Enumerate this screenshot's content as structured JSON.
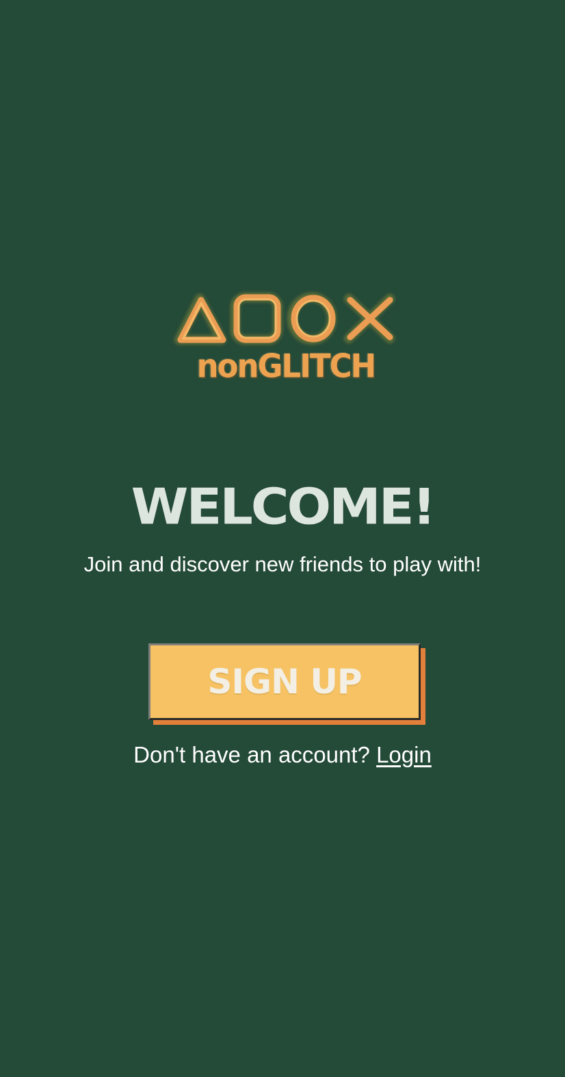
{
  "app": {
    "logo": {
      "wordmark": "nonGLITCH",
      "symbol_icons": [
        "triangle-icon",
        "square-icon",
        "circle-icon",
        "cross-icon"
      ]
    }
  },
  "welcome": {
    "title": "WELCOME!",
    "subtitle": "Join and discover new friends to play with!"
  },
  "actions": {
    "signup_label": "SIGN UP",
    "account_prompt": "Don't have an account?",
    "login_link": "Login"
  },
  "colors": {
    "background": "#244a38",
    "logo_orange": "#eda24f",
    "title_text": "#dde5df",
    "button_fill": "#f6c263",
    "button_shadow": "#e27f3a"
  }
}
